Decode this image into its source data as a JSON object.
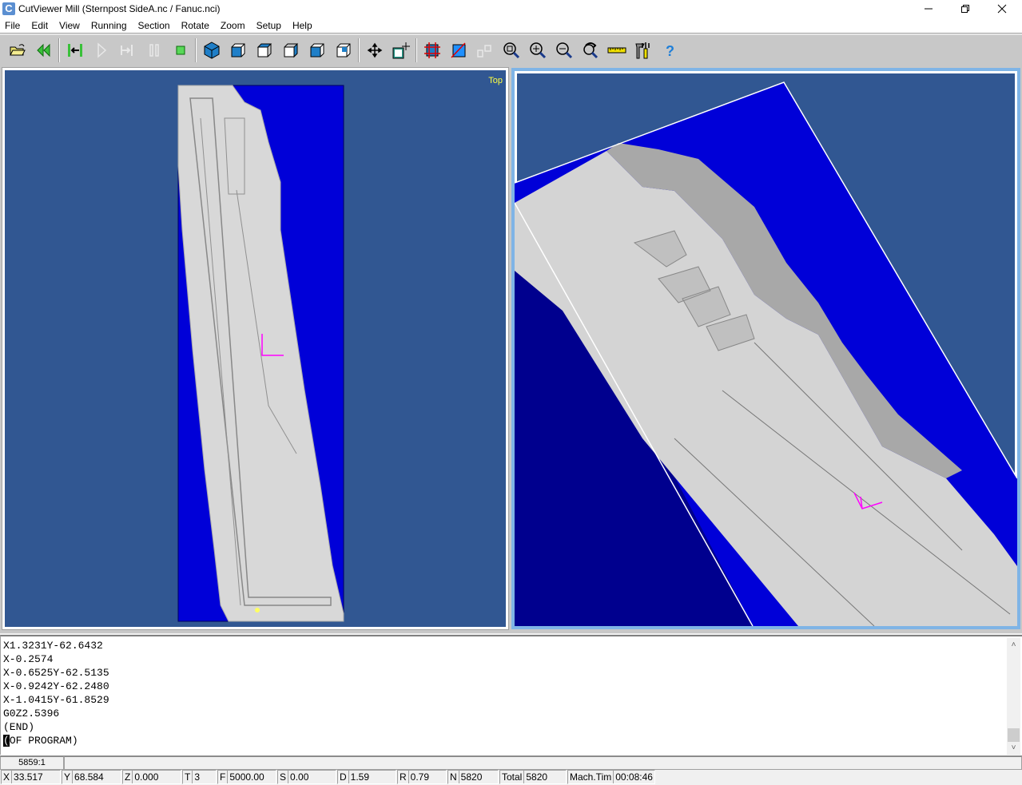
{
  "window": {
    "title": "CutViewer Mill (Sternpost SideA.nc / Fanuc.nci)",
    "app_icon": "cutviewer-logo-icon",
    "controls": [
      "minimize",
      "restore",
      "close"
    ]
  },
  "menu": {
    "items": [
      "File",
      "Edit",
      "View",
      "Running",
      "Section",
      "Rotate",
      "Zoom",
      "Setup",
      "Help"
    ]
  },
  "toolbar": {
    "buttons": [
      {
        "icon": "open-folder-icon",
        "tooltip": "Open"
      },
      {
        "icon": "rewind-icon",
        "tooltip": "Restart"
      },
      {
        "icon": "step-back-to-start-icon",
        "tooltip": "Go to start"
      },
      {
        "icon": "play-icon",
        "tooltip": "Run",
        "disabled": true
      },
      {
        "icon": "step-forward-icon",
        "tooltip": "Step",
        "disabled": true
      },
      {
        "icon": "pause-icon",
        "tooltip": "Pause",
        "disabled": true
      },
      {
        "icon": "stop-icon",
        "tooltip": "Stop"
      },
      {
        "icon": "isometric-view-icon",
        "tooltip": "Isometric view"
      },
      {
        "icon": "front-view-icon",
        "tooltip": "Front view"
      },
      {
        "icon": "top-view-icon",
        "tooltip": "Top view"
      },
      {
        "icon": "right-view-icon",
        "tooltip": "Right view"
      },
      {
        "icon": "back-view-icon",
        "tooltip": "Back view"
      },
      {
        "icon": "left-view-icon",
        "tooltip": "Left view"
      },
      {
        "icon": "pan-icon",
        "tooltip": "Pan"
      },
      {
        "icon": "hand-rotate-icon",
        "tooltip": "Rotate"
      },
      {
        "icon": "grid-section-icon",
        "tooltip": "Section grid"
      },
      {
        "icon": "section-cut-icon",
        "tooltip": "Section"
      },
      {
        "icon": "multi-view-icon",
        "tooltip": "Views",
        "disabled": true
      },
      {
        "icon": "zoom-window-icon",
        "tooltip": "Zoom window"
      },
      {
        "icon": "zoom-in-icon",
        "tooltip": "Zoom in"
      },
      {
        "icon": "zoom-out-icon",
        "tooltip": "Zoom out"
      },
      {
        "icon": "zoom-dynamic-icon",
        "tooltip": "Dynamic zoom"
      },
      {
        "icon": "ruler-icon",
        "tooltip": "Measure"
      },
      {
        "icon": "tools-settings-icon",
        "tooltip": "Setup"
      },
      {
        "icon": "help-icon",
        "tooltip": "Help"
      }
    ]
  },
  "viewports": {
    "left": {
      "label": "Top"
    },
    "right": {
      "label": ""
    }
  },
  "colors": {
    "viewport_bg": "#315792",
    "stock": "#0000d8",
    "part": "#d8d8d8",
    "tool_marker": "#ff00ff",
    "view_label": "#ffff40"
  },
  "nc_code": {
    "lines": [
      "X1.3231Y-62.6432",
      "X-0.2574",
      "X-0.6525Y-62.5135",
      "X-0.9242Y-62.2480",
      "X-1.0415Y-61.8529",
      "G0Z2.5396",
      "(END)",
      "(OF PROGRAM)"
    ],
    "cursor_line": 7
  },
  "status": {
    "position": "5859:1",
    "fields": [
      {
        "label": "X",
        "value": "33.517"
      },
      {
        "label": "Y",
        "value": "68.584"
      },
      {
        "label": "Z",
        "value": "0.000"
      },
      {
        "label": "T",
        "value": "3"
      },
      {
        "label": "F",
        "value": "5000.00"
      },
      {
        "label": "S",
        "value": "0.00"
      },
      {
        "label": "D",
        "value": "1.59"
      },
      {
        "label": "R",
        "value": "0.79"
      },
      {
        "label": "N",
        "value": "5820"
      },
      {
        "label": "Total",
        "value": "5820"
      },
      {
        "label": "Mach.Tim",
        "value": "00:08:46"
      }
    ]
  }
}
